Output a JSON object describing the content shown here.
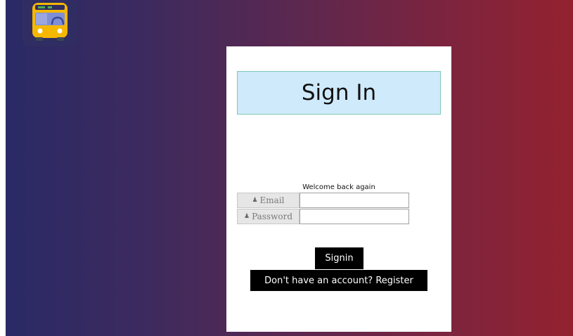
{
  "logo": {
    "icon": "bus-icon"
  },
  "signin_card": {
    "title": "Sign In",
    "welcome": "Welcome back again",
    "email_label": "Email",
    "email_value": "",
    "password_label": "Password",
    "password_value": "",
    "signin_button": "Signin",
    "register_button": "Don't have an account? Register",
    "field_icon": "user-icon"
  },
  "colors": {
    "gradient_start": "#2a2a66",
    "gradient_end": "#93222f",
    "title_bg": "#cfeafa",
    "button_bg": "#000000"
  }
}
